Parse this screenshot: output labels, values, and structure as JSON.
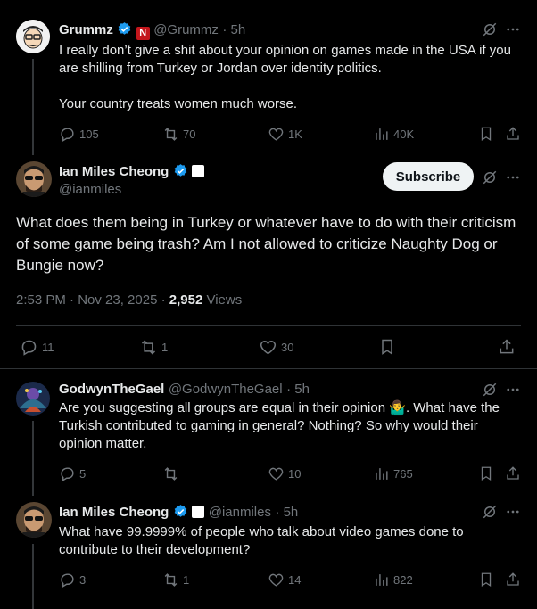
{
  "tweet1": {
    "name": "Grummz",
    "handle": "@Grummz",
    "time": "· 5h",
    "text1": "I really don’t give a shit about your opinion on games made in the USA if you are shilling from Turkey or Jordan over identity politics.",
    "text2": "Your country treats women much worse.",
    "replies": "105",
    "reposts": "70",
    "likes": "1K",
    "views": "40K"
  },
  "main": {
    "name": "Ian Miles Cheong",
    "handle": "@ianmiles",
    "subscribe_label": "Subscribe",
    "text": "What does them being in Turkey or whatever have to do with their criticism of some game being trash? Am I not allowed to criticize Naughty Dog or Bungie now?",
    "timestamp": "2:53 PM · Nov 23, 2025 · ",
    "views_count": "2,952",
    "views_label": " Views",
    "replies": "11",
    "reposts": "1",
    "likes": "30"
  },
  "reply1": {
    "name": "GodwynTheGael",
    "handle": "@GodwynTheGael",
    "time": "· 5h",
    "text_a": "Are you suggesting all groups are equal in their opinion ",
    "emoji": "🤷‍♂️",
    "text_b": ". What have the Turkish contributed to gaming in general? Nothing? So why would their opinion matter.",
    "replies": "5",
    "likes": "10",
    "views": "765"
  },
  "reply2": {
    "name": "Ian Miles Cheong",
    "handle": "@ianmiles",
    "time": "· 5h",
    "text": "What have 99.9999% of people who talk about video games done to contribute to their development?",
    "replies": "3",
    "reposts": "1",
    "likes": "14",
    "views": "822"
  },
  "colors": {
    "verified": "#1d9bf0",
    "background": "#000000",
    "text": "#e7e9ea",
    "muted": "#71767b"
  }
}
